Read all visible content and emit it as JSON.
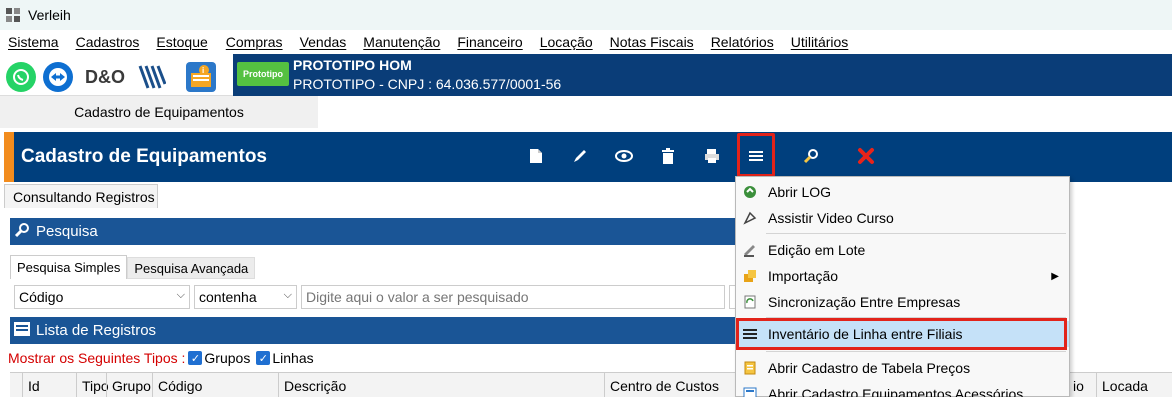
{
  "window": {
    "title": "Verleih"
  },
  "menu": [
    "Sistema",
    "Cadastros",
    "Estoque",
    "Compras",
    "Vendas",
    "Manutenção",
    "Financeiro",
    "Locação",
    "Notas Fiscais",
    "Relatórios",
    "Utilitários"
  ],
  "quick_icons": [
    {
      "name": "whatsapp-icon",
      "color": "#25d366"
    },
    {
      "name": "teamviewer-icon",
      "color": "#0e6fd1"
    },
    {
      "name": "dno-logo-icon",
      "color": "#3a3a3a"
    },
    {
      "name": "stripes-logo-icon",
      "color": "#1b4f8a"
    },
    {
      "name": "notification-icon",
      "color": "#2c78c9"
    }
  ],
  "company": {
    "logo_text": "Prototipo",
    "name": "PROTOTIPO HOM",
    "cnpj_line": "PROTOTIPO - CNPJ : 64.036.577/0001-56"
  },
  "doc_tab": "Cadastro de Equipamentos",
  "header": {
    "title": "Cadastro de Equipamentos",
    "accent_color": "#f28c1e",
    "bar_color": "#003f7d",
    "toolbar": [
      {
        "name": "new-icon",
        "glyph": "🗋"
      },
      {
        "name": "edit-icon",
        "glyph": "✎"
      },
      {
        "name": "view-icon",
        "glyph": "👁"
      },
      {
        "name": "delete-icon",
        "glyph": "🗑"
      },
      {
        "name": "print-icon",
        "glyph": "⎙"
      },
      {
        "name": "menu-icon",
        "glyph": "≡"
      },
      {
        "name": "search-tool-icon",
        "glyph": "🔍"
      },
      {
        "name": "close-icon",
        "glyph": "✖"
      }
    ]
  },
  "sub_tab": "Consultando Registros",
  "search_section": {
    "title": "Pesquisa",
    "tabs": [
      "Pesquisa Simples",
      "Pesquisa Avançada"
    ],
    "field_select": "Código",
    "operator_select": "contenha",
    "input_placeholder": "Digite aqui o valor a ser pesquisado"
  },
  "list_section": {
    "title": "Lista de Registros",
    "types_label": "Mostrar os Seguintes Tipos :",
    "types": [
      "Grupos",
      "Linhas"
    ],
    "columns": [
      "Id",
      "Tipo",
      "Grupo",
      "Código",
      "Descrição",
      "Centro de Custos",
      "io",
      "Locada"
    ]
  },
  "dropdown_menu": {
    "items": [
      {
        "label": "Abrir LOG",
        "icon": "log-icon",
        "glyph": "◉"
      },
      {
        "label": "Assistir Video Curso",
        "icon": "video-icon",
        "glyph": "◈"
      },
      {
        "label": "Edição em Lote",
        "icon": "batch-edit-icon",
        "glyph": "✎"
      },
      {
        "label": "Importação",
        "icon": "import-icon",
        "glyph": "▣",
        "submenu": "▶"
      },
      {
        "label": "Sincronização Entre Empresas",
        "icon": "sync-icon",
        "glyph": "⟳"
      },
      {
        "label": "Inventário de Linha entre Filiais",
        "icon": "inventory-icon",
        "glyph": "≡"
      },
      {
        "label": "Abrir Cadastro de Tabela Preços",
        "icon": "price-table-icon",
        "glyph": "▤"
      },
      {
        "label": "Abrir Cadastro Equipamentos Acessórios",
        "icon": "accessories-icon",
        "glyph": "▦"
      }
    ],
    "highlight_color": "#e2231a"
  }
}
